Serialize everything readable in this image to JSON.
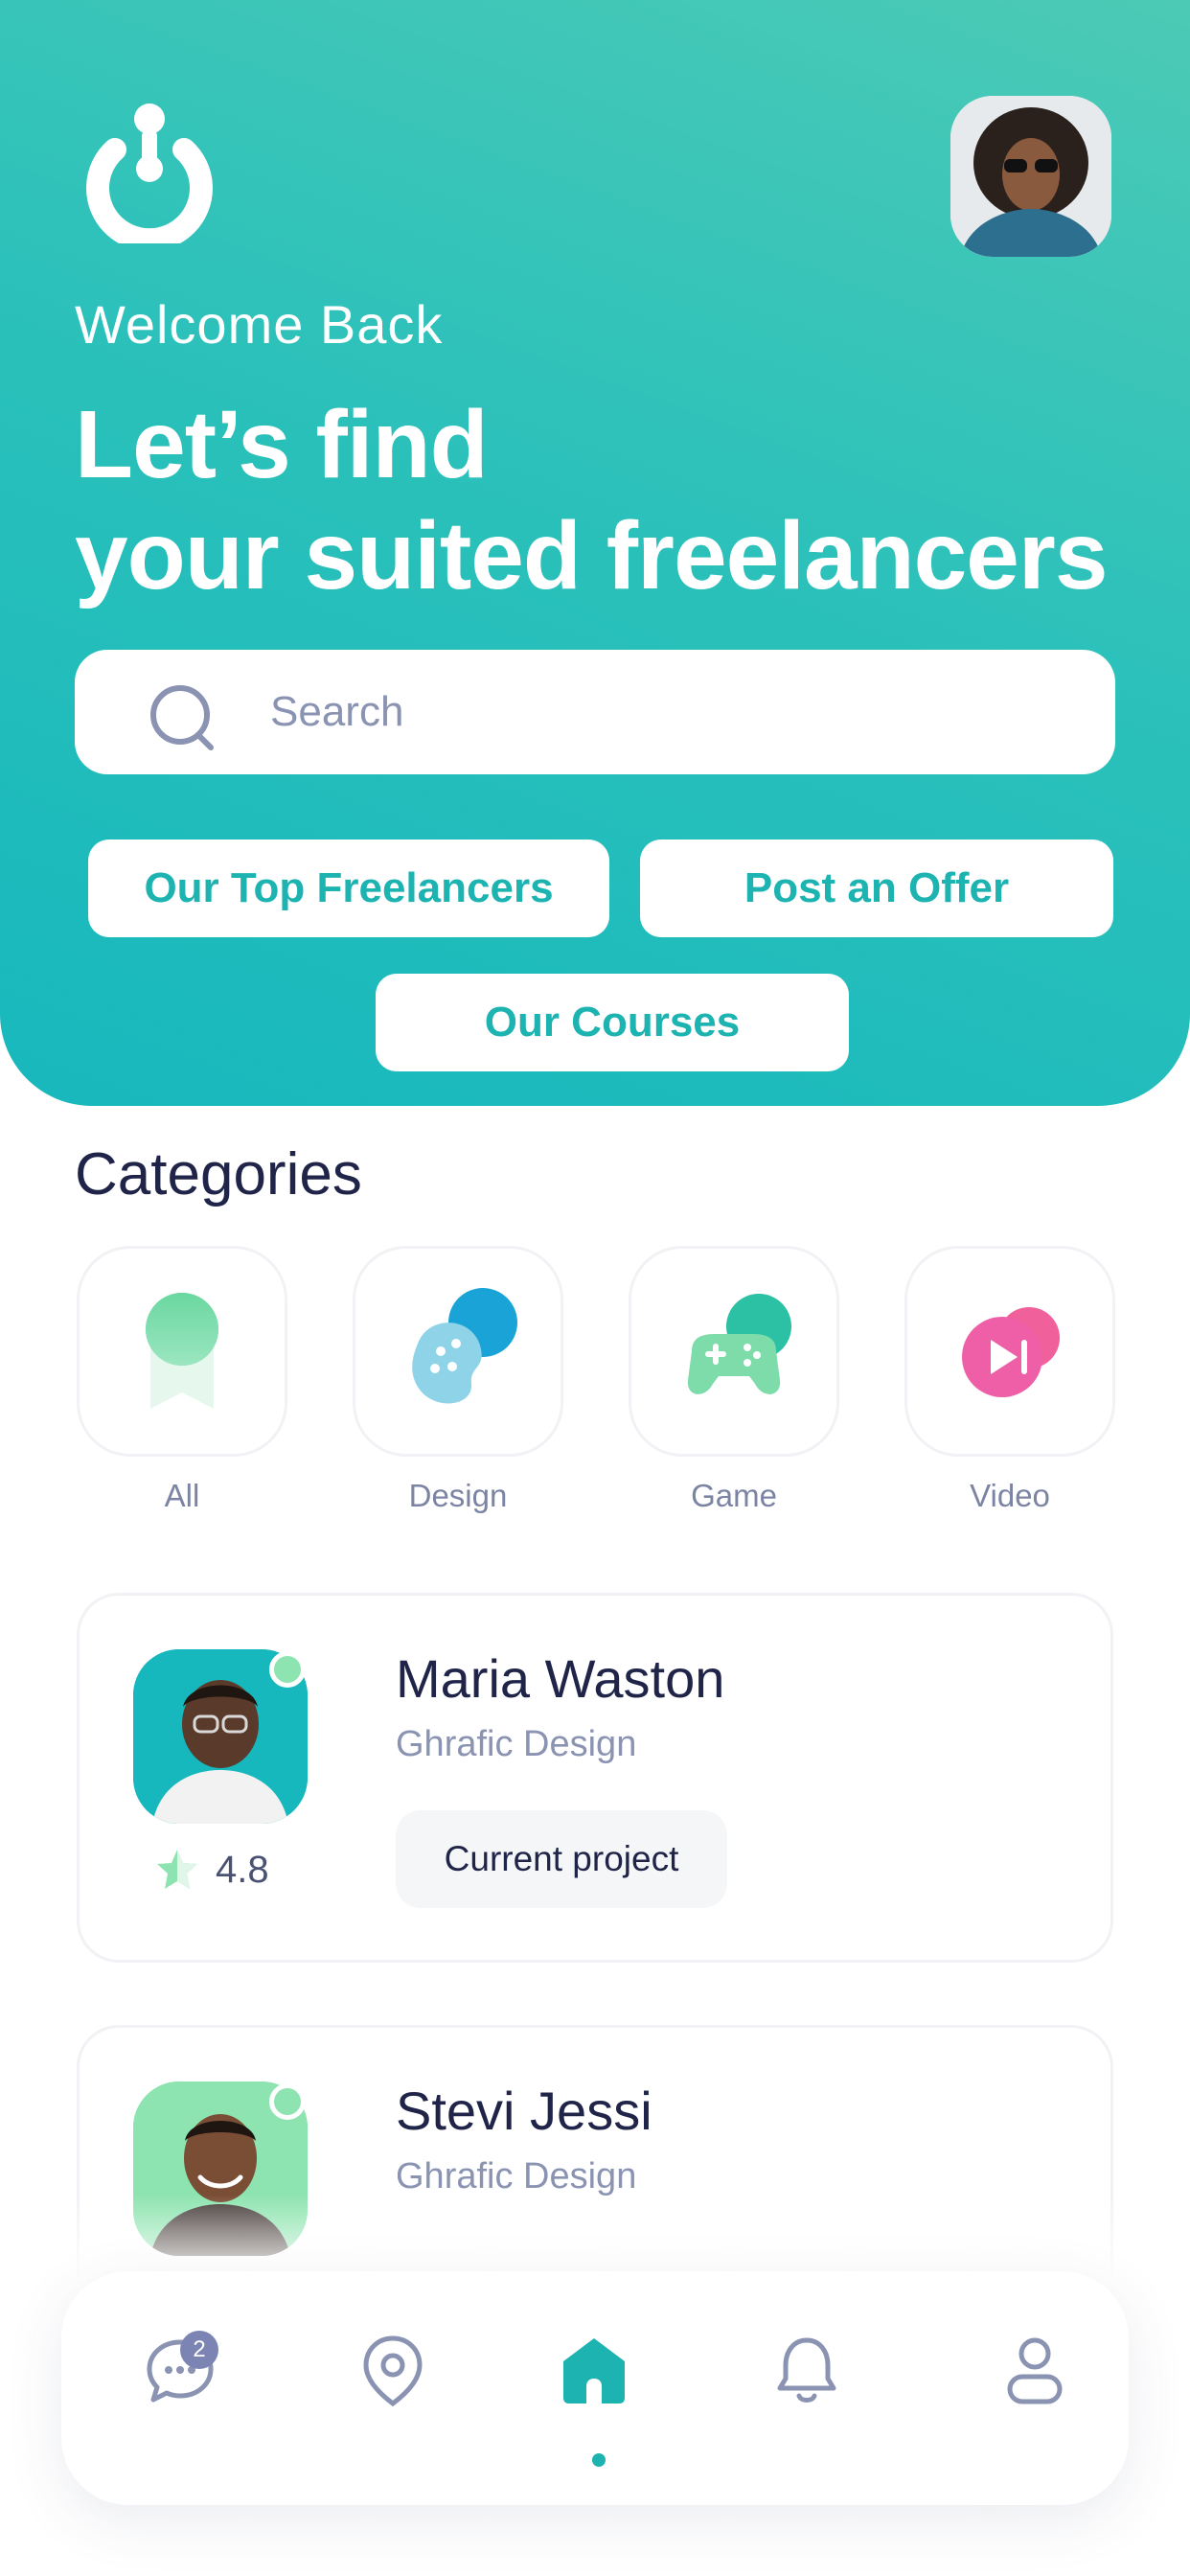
{
  "header": {
    "welcome": "Welcome Back",
    "headline_line1": "Let’s find",
    "headline_line2": "your suited freelancers",
    "logo_icon": "power-logo-icon",
    "profile_avatar": "profile-avatar"
  },
  "search": {
    "placeholder": "Search",
    "value": "",
    "icon": "search-icon"
  },
  "actions": [
    {
      "label": "Our Top Freelancers"
    },
    {
      "label": "Post an Offer"
    },
    {
      "label": "Our Courses"
    }
  ],
  "categories": {
    "title": "Categories",
    "items": [
      {
        "label": "All",
        "icon": "badge-icon"
      },
      {
        "label": "Design",
        "icon": "palette-icon"
      },
      {
        "label": "Game",
        "icon": "gamepad-icon"
      },
      {
        "label": "Video",
        "icon": "video-play-icon"
      }
    ]
  },
  "freelancers": [
    {
      "name": "Maria Waston",
      "role": "Ghrafic Design",
      "tag": "Current project",
      "rating": "4.8",
      "avatar_bg": "#17b8bd"
    },
    {
      "name": "Stevi Jessi",
      "role": "Ghrafic Design",
      "tag": "",
      "rating": "",
      "avatar_bg": "#8ee4b0"
    }
  ],
  "tabbar": {
    "items": [
      {
        "icon": "chat-icon",
        "badge": "2"
      },
      {
        "icon": "location-pin-icon"
      },
      {
        "icon": "home-icon",
        "active": true
      },
      {
        "icon": "bell-icon"
      },
      {
        "icon": "user-icon"
      }
    ]
  },
  "colors": {
    "accent": "#1cb3b1",
    "hero_gradient_start": "#4ccab6",
    "hero_gradient_end": "#17b8bd",
    "text_dark": "#1f2448",
    "text_muted": "#8a93b2",
    "online_green": "#8ee4b0"
  }
}
